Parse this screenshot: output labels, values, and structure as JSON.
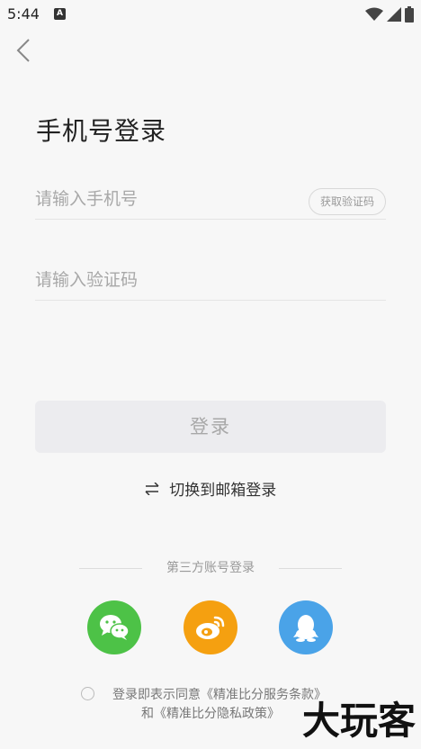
{
  "status_bar": {
    "time": "5:44",
    "badge": "A"
  },
  "header": {
    "back_icon": "chevron-left-icon"
  },
  "title": "手机号登录",
  "phone_field": {
    "placeholder": "请输入手机号",
    "value": "",
    "get_code_label": "获取验证码"
  },
  "code_field": {
    "placeholder": "请输入验证码",
    "value": ""
  },
  "login_button": "登录",
  "switch_login": {
    "icon": "swap-arrows-icon",
    "label": "切换到邮箱登录"
  },
  "third_party": {
    "label": "第三方账号登录",
    "providers": [
      {
        "name": "wechat",
        "icon": "wechat-icon",
        "color": "#4dc247"
      },
      {
        "name": "weibo",
        "icon": "weibo-icon",
        "color": "#f5a010"
      },
      {
        "name": "qq",
        "icon": "qq-icon",
        "color": "#4aa3e8"
      }
    ]
  },
  "agreement": {
    "prefix": "登录即表示同意",
    "terms": "《精准比分服务条款》",
    "and": "和",
    "privacy": "《精准比分隐私政策》"
  },
  "watermark": "大玩客"
}
